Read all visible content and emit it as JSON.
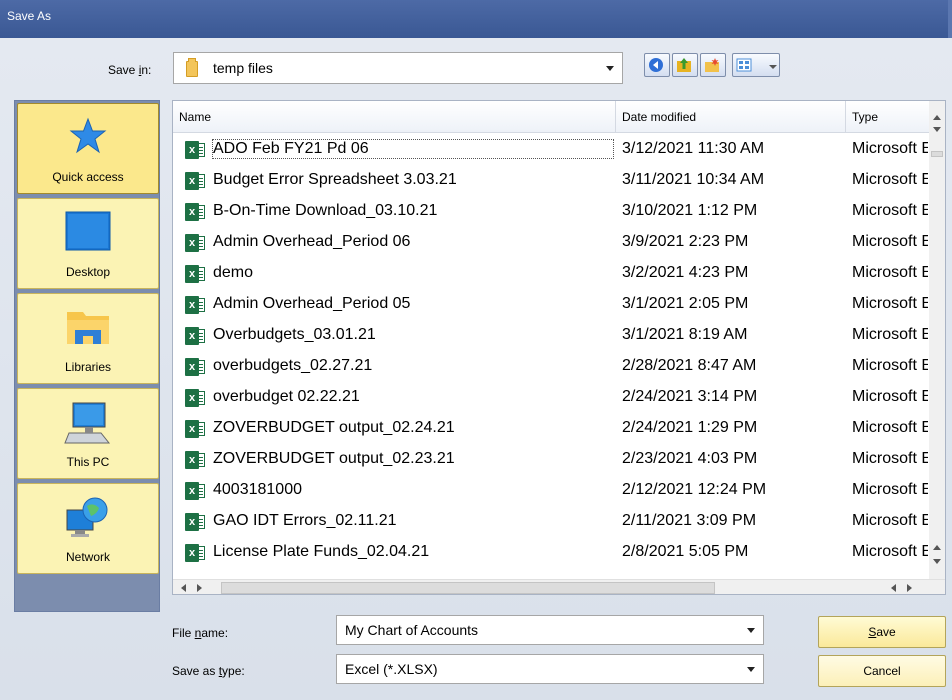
{
  "window": {
    "title": "Save As"
  },
  "save_in": {
    "label_pre": "Save ",
    "label_key": "i",
    "label_post": "n:",
    "value": "temp files"
  },
  "toolbar": {
    "buttons": [
      {
        "icon": "back-icon",
        "color": "#2f6fd6"
      },
      {
        "icon": "up-folder-icon",
        "color": "#e7b322"
      },
      {
        "icon": "new-folder-icon",
        "color": "#f2c14a"
      },
      {
        "icon": "views-menu-icon",
        "color": "#4c8fd8"
      }
    ]
  },
  "places": [
    {
      "label": "Quick access",
      "icon": "star-icon",
      "active": true
    },
    {
      "label": "Desktop",
      "icon": "desktop-icon",
      "active": false
    },
    {
      "label": "Libraries",
      "icon": "libraries-icon",
      "active": false
    },
    {
      "label": "This PC",
      "icon": "computer-icon",
      "active": false
    },
    {
      "label": "Network",
      "icon": "network-icon",
      "active": false
    }
  ],
  "list": {
    "columns": [
      {
        "label": "Name"
      },
      {
        "label": "Date modified"
      },
      {
        "label": "Type"
      }
    ],
    "rows": [
      {
        "name": "ADO Feb FY21 Pd 06",
        "date": "3/12/2021 11:30 AM",
        "type": "Microsoft Excel Worksheet",
        "selected": true
      },
      {
        "name": "Budget Error Spreadsheet 3.03.21",
        "date": "3/11/2021 10:34 AM",
        "type": "Microsoft Excel Worksheet"
      },
      {
        "name": "B-On-Time Download_03.10.21",
        "date": "3/10/2021 1:12 PM",
        "type": "Microsoft Excel Worksheet"
      },
      {
        "name": "Admin Overhead_Period 06",
        "date": "3/9/2021 2:23 PM",
        "type": "Microsoft Excel Worksheet"
      },
      {
        "name": "demo",
        "date": "3/2/2021 4:23 PM",
        "type": "Microsoft Excel Worksheet"
      },
      {
        "name": "Admin Overhead_Period 05",
        "date": "3/1/2021 2:05 PM",
        "type": "Microsoft Excel Worksheet"
      },
      {
        "name": "Overbudgets_03.01.21",
        "date": "3/1/2021 8:19 AM",
        "type": "Microsoft Excel Worksheet"
      },
      {
        "name": "overbudgets_02.27.21",
        "date": "2/28/2021 8:47 AM",
        "type": "Microsoft Excel Worksheet"
      },
      {
        "name": "overbudget 02.22.21",
        "date": "2/24/2021 3:14 PM",
        "type": "Microsoft Excel Worksheet"
      },
      {
        "name": "ZOVERBUDGET output_02.24.21",
        "date": "2/24/2021 1:29 PM",
        "type": "Microsoft Excel Worksheet"
      },
      {
        "name": "ZOVERBUDGET output_02.23.21",
        "date": "2/23/2021 4:03 PM",
        "type": "Microsoft Excel Worksheet"
      },
      {
        "name": "4003181000",
        "date": "2/12/2021 12:24 PM",
        "type": "Microsoft Excel Worksheet"
      },
      {
        "name": "GAO IDT Errors_02.11.21",
        "date": "2/11/2021 3:09 PM",
        "type": "Microsoft Excel Worksheet"
      },
      {
        "name": "License Plate Funds_02.04.21",
        "date": "2/8/2021 5:05 PM",
        "type": "Microsoft Excel Worksheet"
      }
    ]
  },
  "file_name": {
    "label_pre": "File ",
    "label_key": "n",
    "label_post": "ame:",
    "value": "My Chart of Accounts"
  },
  "save_type": {
    "label_pre": "Save as ",
    "label_key": "t",
    "label_post": "ype:",
    "value": "Excel (*.XLSX)"
  },
  "buttons": {
    "save_key": "S",
    "save_rest": "ave",
    "cancel": "Cancel"
  },
  "colors": {
    "title_bar": "#3a5894",
    "places_bar": "#7c8dae",
    "place_button": "#fbf3b4",
    "excel_green": "#1d7044"
  }
}
